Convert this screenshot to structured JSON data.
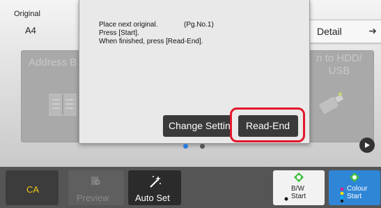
{
  "original": {
    "label": "Original",
    "value": "A4"
  },
  "detail": {
    "label": "Detail",
    "icon": "arrow-right-icon"
  },
  "tiles": {
    "address": "Address B",
    "hdd_line1": "n to HDD/",
    "hdd_line2": "USB"
  },
  "dialog": {
    "line1": "Place next original.",
    "page_no": "(Pg.No.1)",
    "line2": "Press [Start].",
    "line3": "When finished, press [Read-End].",
    "change_button": "Change Settin",
    "read_end_button": "Read-End",
    "highlight_color": "#e3162a"
  },
  "pager": {
    "active_color": "#2a79e0"
  },
  "bottom": {
    "ca": "CA",
    "preview": "Preview",
    "auto_set": "Auto Set",
    "bw": {
      "line1": "B/W",
      "line2": "Start"
    },
    "colour": {
      "line1": "Colour",
      "line2": "Start"
    },
    "ca_color": "#f0c419",
    "colour_button_color": "#2f86d6"
  }
}
